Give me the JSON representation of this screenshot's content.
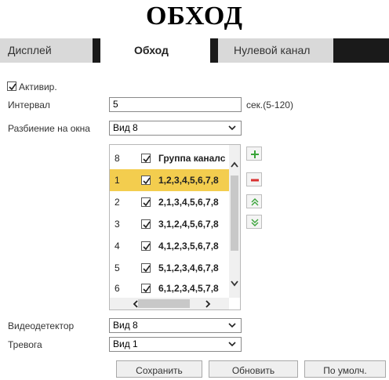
{
  "page_title": "ОБХОД",
  "tabs": [
    {
      "label": "Дисплей",
      "active": false
    },
    {
      "label": "Обход",
      "active": true
    },
    {
      "label": "Нулевой канал",
      "active": false
    }
  ],
  "form": {
    "enable_label": "Активир.",
    "enable_checked": true,
    "interval_label": "Интервал",
    "interval_value": "5",
    "interval_hint": "сек.(5-120)",
    "split_label": "Разбиение на окна",
    "split_value": "Вид 8",
    "motion_label": "Видеодетектор",
    "motion_value": "Вид 8",
    "alarm_label": "Тревога",
    "alarm_value": "Вид 1"
  },
  "group_list": {
    "header": {
      "num": "8",
      "text": "Группа каналс"
    },
    "rows": [
      {
        "num": "1",
        "text": "1,2,3,4,5,6,7,8",
        "checked": true,
        "selected": true
      },
      {
        "num": "2",
        "text": "2,1,3,4,5,6,7,8",
        "checked": true,
        "selected": false
      },
      {
        "num": "3",
        "text": "3,1,2,4,5,6,7,8",
        "checked": true,
        "selected": false
      },
      {
        "num": "4",
        "text": "4,1,2,3,5,6,7,8",
        "checked": true,
        "selected": false
      },
      {
        "num": "5",
        "text": "5,1,2,3,4,6,7,8",
        "checked": true,
        "selected": false
      },
      {
        "num": "6",
        "text": "6,1,2,3,4,5,7,8",
        "checked": true,
        "selected": false
      }
    ]
  },
  "side_buttons": [
    "add-icon",
    "remove-icon",
    "move-up-icon",
    "move-down-icon"
  ],
  "buttons": {
    "save": "Сохранить",
    "refresh": "Обновить",
    "default": "По умолч."
  },
  "colors": {
    "selected_row": "#f3cd4e",
    "add": "#3aa43a",
    "remove": "#d93030",
    "move": "#3aa43a",
    "tab_separator": "#1a1a1a"
  }
}
